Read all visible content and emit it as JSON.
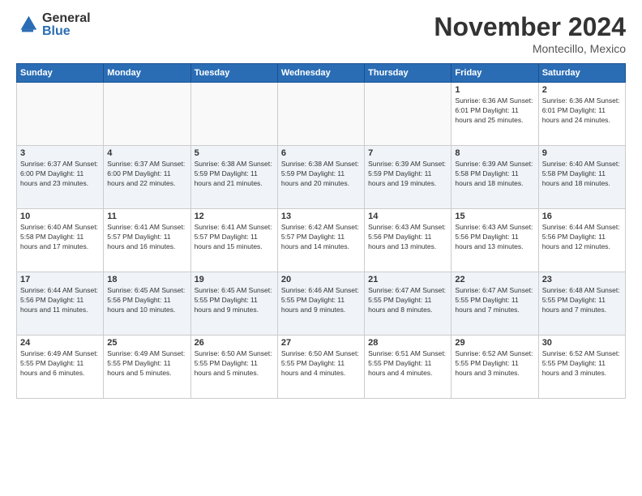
{
  "logo": {
    "general": "General",
    "blue": "Blue"
  },
  "title": "November 2024",
  "subtitle": "Montecillo, Mexico",
  "days_of_week": [
    "Sunday",
    "Monday",
    "Tuesday",
    "Wednesday",
    "Thursday",
    "Friday",
    "Saturday"
  ],
  "weeks": [
    [
      {
        "day": "",
        "info": ""
      },
      {
        "day": "",
        "info": ""
      },
      {
        "day": "",
        "info": ""
      },
      {
        "day": "",
        "info": ""
      },
      {
        "day": "",
        "info": ""
      },
      {
        "day": "1",
        "info": "Sunrise: 6:36 AM\nSunset: 6:01 PM\nDaylight: 11 hours and 25 minutes."
      },
      {
        "day": "2",
        "info": "Sunrise: 6:36 AM\nSunset: 6:01 PM\nDaylight: 11 hours and 24 minutes."
      }
    ],
    [
      {
        "day": "3",
        "info": "Sunrise: 6:37 AM\nSunset: 6:00 PM\nDaylight: 11 hours and 23 minutes."
      },
      {
        "day": "4",
        "info": "Sunrise: 6:37 AM\nSunset: 6:00 PM\nDaylight: 11 hours and 22 minutes."
      },
      {
        "day": "5",
        "info": "Sunrise: 6:38 AM\nSunset: 5:59 PM\nDaylight: 11 hours and 21 minutes."
      },
      {
        "day": "6",
        "info": "Sunrise: 6:38 AM\nSunset: 5:59 PM\nDaylight: 11 hours and 20 minutes."
      },
      {
        "day": "7",
        "info": "Sunrise: 6:39 AM\nSunset: 5:59 PM\nDaylight: 11 hours and 19 minutes."
      },
      {
        "day": "8",
        "info": "Sunrise: 6:39 AM\nSunset: 5:58 PM\nDaylight: 11 hours and 18 minutes."
      },
      {
        "day": "9",
        "info": "Sunrise: 6:40 AM\nSunset: 5:58 PM\nDaylight: 11 hours and 18 minutes."
      }
    ],
    [
      {
        "day": "10",
        "info": "Sunrise: 6:40 AM\nSunset: 5:58 PM\nDaylight: 11 hours and 17 minutes."
      },
      {
        "day": "11",
        "info": "Sunrise: 6:41 AM\nSunset: 5:57 PM\nDaylight: 11 hours and 16 minutes."
      },
      {
        "day": "12",
        "info": "Sunrise: 6:41 AM\nSunset: 5:57 PM\nDaylight: 11 hours and 15 minutes."
      },
      {
        "day": "13",
        "info": "Sunrise: 6:42 AM\nSunset: 5:57 PM\nDaylight: 11 hours and 14 minutes."
      },
      {
        "day": "14",
        "info": "Sunrise: 6:43 AM\nSunset: 5:56 PM\nDaylight: 11 hours and 13 minutes."
      },
      {
        "day": "15",
        "info": "Sunrise: 6:43 AM\nSunset: 5:56 PM\nDaylight: 11 hours and 13 minutes."
      },
      {
        "day": "16",
        "info": "Sunrise: 6:44 AM\nSunset: 5:56 PM\nDaylight: 11 hours and 12 minutes."
      }
    ],
    [
      {
        "day": "17",
        "info": "Sunrise: 6:44 AM\nSunset: 5:56 PM\nDaylight: 11 hours and 11 minutes."
      },
      {
        "day": "18",
        "info": "Sunrise: 6:45 AM\nSunset: 5:56 PM\nDaylight: 11 hours and 10 minutes."
      },
      {
        "day": "19",
        "info": "Sunrise: 6:45 AM\nSunset: 5:55 PM\nDaylight: 11 hours and 9 minutes."
      },
      {
        "day": "20",
        "info": "Sunrise: 6:46 AM\nSunset: 5:55 PM\nDaylight: 11 hours and 9 minutes."
      },
      {
        "day": "21",
        "info": "Sunrise: 6:47 AM\nSunset: 5:55 PM\nDaylight: 11 hours and 8 minutes."
      },
      {
        "day": "22",
        "info": "Sunrise: 6:47 AM\nSunset: 5:55 PM\nDaylight: 11 hours and 7 minutes."
      },
      {
        "day": "23",
        "info": "Sunrise: 6:48 AM\nSunset: 5:55 PM\nDaylight: 11 hours and 7 minutes."
      }
    ],
    [
      {
        "day": "24",
        "info": "Sunrise: 6:49 AM\nSunset: 5:55 PM\nDaylight: 11 hours and 6 minutes."
      },
      {
        "day": "25",
        "info": "Sunrise: 6:49 AM\nSunset: 5:55 PM\nDaylight: 11 hours and 5 minutes."
      },
      {
        "day": "26",
        "info": "Sunrise: 6:50 AM\nSunset: 5:55 PM\nDaylight: 11 hours and 5 minutes."
      },
      {
        "day": "27",
        "info": "Sunrise: 6:50 AM\nSunset: 5:55 PM\nDaylight: 11 hours and 4 minutes."
      },
      {
        "day": "28",
        "info": "Sunrise: 6:51 AM\nSunset: 5:55 PM\nDaylight: 11 hours and 4 minutes."
      },
      {
        "day": "29",
        "info": "Sunrise: 6:52 AM\nSunset: 5:55 PM\nDaylight: 11 hours and 3 minutes."
      },
      {
        "day": "30",
        "info": "Sunrise: 6:52 AM\nSunset: 5:55 PM\nDaylight: 11 hours and 3 minutes."
      }
    ]
  ]
}
